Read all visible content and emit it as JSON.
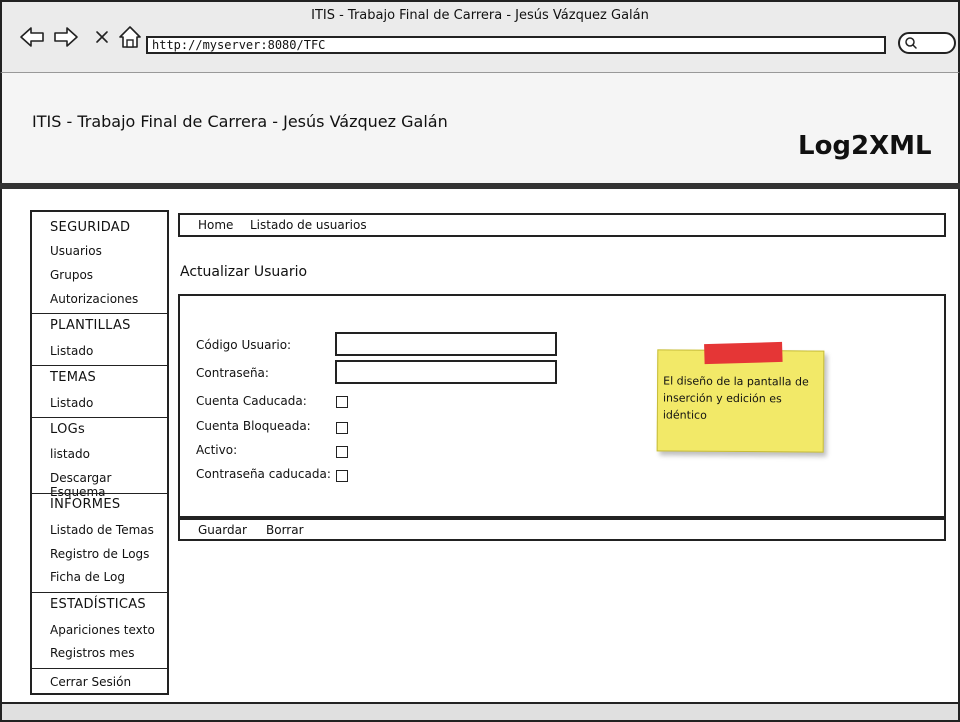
{
  "browser": {
    "window_title": "ITIS - Trabajo Final de Carrera -  Jesús Vázquez Galán",
    "url": "http://myserver:8080/TFC",
    "icons": [
      "back-arrow-icon",
      "forward-arrow-icon",
      "close-icon",
      "home-icon",
      "search-icon"
    ]
  },
  "header": {
    "title": "ITIS - Trabajo Final de Carrera - Jesús Vázquez Galán",
    "brand": "Log2XML"
  },
  "sidebar": {
    "sections": [
      {
        "heading": "SEGURIDAD",
        "items": [
          "Usuarios",
          "Grupos",
          "Autorizaciones"
        ]
      },
      {
        "heading": "PLANTILLAS",
        "items": [
          "Listado"
        ]
      },
      {
        "heading": "TEMAS",
        "items": [
          "Listado"
        ]
      },
      {
        "heading": "LOGs",
        "items": [
          "listado",
          "Descargar Esquema"
        ]
      },
      {
        "heading": "INFORMES",
        "items": [
          "Listado de Temas",
          "Registro de Logs",
          "Ficha de Log"
        ]
      },
      {
        "heading": "ESTADÍSTICAS",
        "items": [
          "Apariciones texto",
          "Registros mes"
        ]
      }
    ],
    "logout": "Cerrar Sesión"
  },
  "breadcrumb": {
    "home": "Home",
    "current": "Listado de usuarios"
  },
  "page_title": "Actualizar Usuario",
  "form": {
    "user_code_label": "Código Usuario:",
    "user_code_value": "",
    "password_label": "Contraseña:",
    "password_value": "",
    "account_expired_label": "Cuenta Caducada:",
    "account_expired_checked": false,
    "account_locked_label": "Cuenta Bloqueada:",
    "account_locked_checked": false,
    "active_label": "Activo:",
    "active_checked": false,
    "password_expired_label": "Contraseña caducada:",
    "password_expired_checked": false
  },
  "actions": {
    "save": "Guardar",
    "delete": "Borrar"
  },
  "note": {
    "text": "El diseño de la pantalla de inserción y edición es idéntico",
    "color": "#f2e968",
    "tape_color": "#e53636"
  }
}
